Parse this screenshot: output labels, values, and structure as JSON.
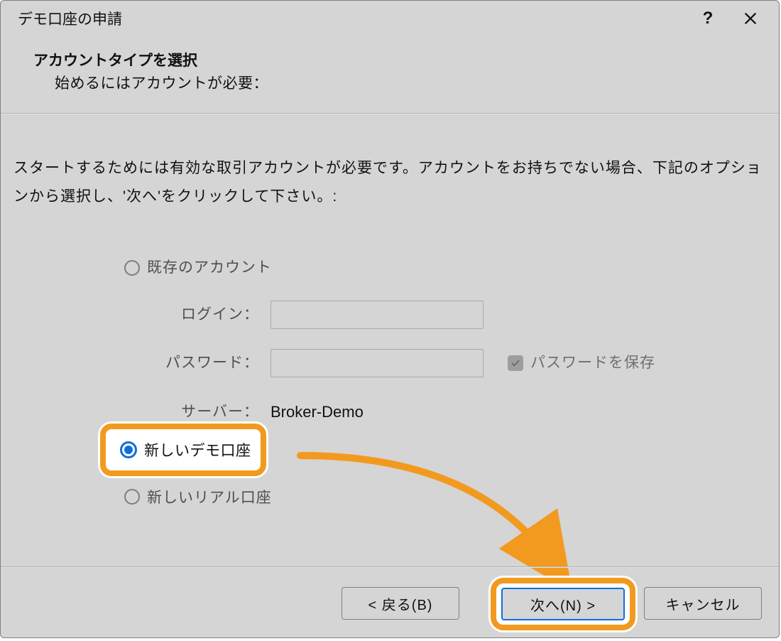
{
  "titlebar": {
    "title": "デモ口座の申請"
  },
  "header": {
    "title": "アカウントタイプを選択",
    "subtitle": "始めるにはアカウントが必要："
  },
  "instruction": "スタートするためには有効な取引アカウントが必要です。アカウントをお持ちでない場合、下記のオプションから選択し、'次へ'をクリックして下さい。:",
  "radios": {
    "existing": "既存のアカウント",
    "new_demo": "新しいデモ口座",
    "new_real": "新しいリアル口座"
  },
  "fields": {
    "login_label": "ログイン：",
    "password_label": "パスワード：",
    "server_label": "サーバー：",
    "server_value": "Broker-Demo",
    "save_password_label": "パスワードを保存"
  },
  "buttons": {
    "back": "< 戻る(B)",
    "next": "次へ(N) >",
    "cancel": "キャンセル"
  }
}
